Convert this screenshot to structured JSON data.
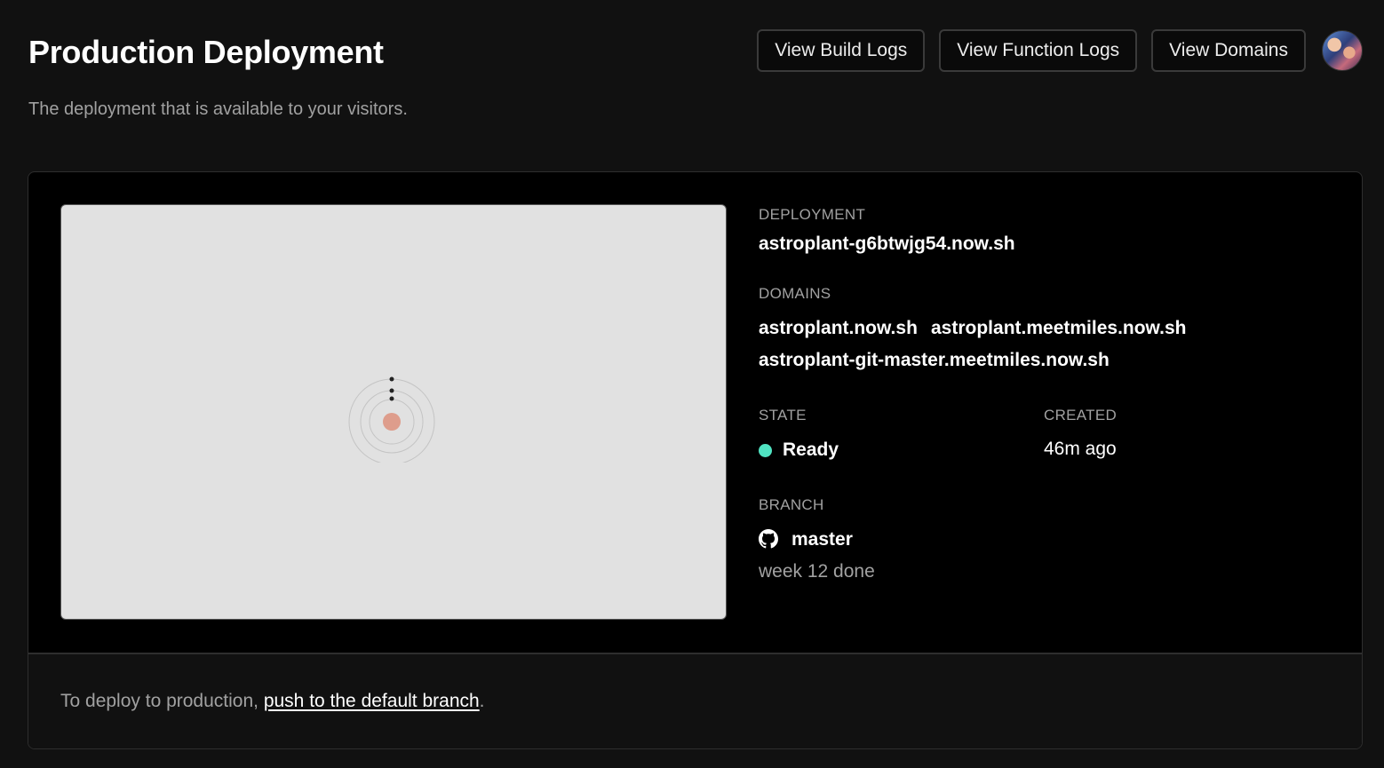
{
  "header": {
    "title": "Production Deployment",
    "subtitle": "The deployment that is available to your visitors."
  },
  "actions": {
    "build_logs": "View Build Logs",
    "function_logs": "View Function Logs",
    "domains": "View Domains"
  },
  "deployment": {
    "label": "DEPLOYMENT",
    "url": "astroplant-g6btwjg54.now.sh"
  },
  "domains": {
    "label": "DOMAINS",
    "items": [
      "astroplant.now.sh",
      "astroplant.meetmiles.now.sh",
      "astroplant-git-master.meetmiles.now.sh"
    ]
  },
  "state": {
    "label": "STATE",
    "value": "Ready",
    "color": "#50e3c2"
  },
  "created": {
    "label": "CREATED",
    "value": "46m ago"
  },
  "branch": {
    "label": "BRANCH",
    "name": "master",
    "icon": "github-icon",
    "commit_message": "week 12 done"
  },
  "footer": {
    "text": "To deploy to production, ",
    "link": "push to the default branch",
    "suffix": "."
  }
}
